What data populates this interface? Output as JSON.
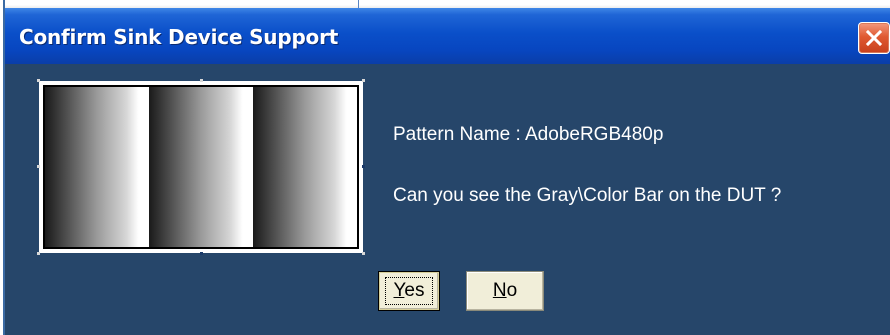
{
  "dialog": {
    "title": "Confirm Sink Device Support",
    "close_icon": "close-icon",
    "colors": {
      "body": "#26466a",
      "titlebar": "#0a4fc9",
      "close": "#e05a32",
      "button_face": "#f1eed9"
    }
  },
  "pattern": {
    "name_line": "Pattern Name : AdobeRGB480p",
    "question": "Can you see the Gray\\Color Bar on the DUT ?"
  },
  "buttons": {
    "yes_label": "Yes",
    "no_label": "No"
  }
}
